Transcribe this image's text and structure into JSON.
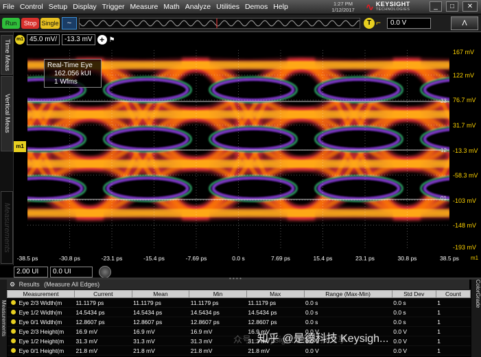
{
  "menu": [
    "File",
    "Control",
    "Setup",
    "Display",
    "Trigger",
    "Measure",
    "Math",
    "Analyze",
    "Utilities",
    "Demos",
    "Help"
  ],
  "datetime": {
    "time": "1:27 PM",
    "date": "1/12/2017"
  },
  "brand": {
    "name": "KEYSIGHT",
    "sub": "TECHNOLOGIES"
  },
  "window_buttons": [
    "_",
    "□",
    "✕"
  ],
  "toolbar": {
    "run": "Run",
    "stop": "Stop",
    "single": "Single",
    "trigger_icon": "T",
    "trigger_level": "0.0 V",
    "ac_icon": "~",
    "autoscale_icon": "Λ"
  },
  "tabs": {
    "time_meas": "Time Meas",
    "vertical_meas": "Vertical Meas",
    "measurements": "Measurements"
  },
  "channel": {
    "badge": "m1",
    "scale": "45.0 mV/",
    "offset": "-13.3 mV",
    "marker": "m1"
  },
  "realtime_label": {
    "title": "Real-Time Eye",
    "count": "162.056 kUI",
    "wfms": "1 Wfms"
  },
  "y_axis": [
    "167 mV",
    "122 mV",
    "76.7 mV",
    "31.7 mV",
    "-13.3 mV",
    "-58.3 mV",
    "-103 mV",
    "-148 mV",
    "-193 mV"
  ],
  "x_axis": [
    "-38.5 ps",
    "-30.8 ps",
    "-23.1 ps",
    "-15.4 ps",
    "-7.69 ps",
    "0.0 s",
    "7.69 ps",
    "15.4 ps",
    "23.1 ps",
    "30.8 ps",
    "38.5 ps"
  ],
  "x_unit": "m1",
  "edge_labels": [
    "23",
    "12",
    "01"
  ],
  "horizontal": {
    "ui": "2.00 UI",
    "position": "0.0 UI"
  },
  "results": {
    "title": "Results",
    "subtitle": "(Measure All Edges)",
    "side_tab": "Measurements",
    "colorgrade_tab": "ColorGrade"
  },
  "table": {
    "headers": [
      "Measurement",
      "Current",
      "Mean",
      "Min",
      "Max",
      "Range (Max-Min)",
      "Std Dev",
      "Count"
    ],
    "rows": [
      [
        "Eye 2/3 Width(m",
        "11.1179 ps",
        "11.1179 ps",
        "11.1179 ps",
        "11.1179 ps",
        "0.0 s",
        "0.0 s",
        "1"
      ],
      [
        "Eye 1/2 Width(m",
        "14.5434 ps",
        "14.5434 ps",
        "14.5434 ps",
        "14.5434 ps",
        "0.0 s",
        "0.0 s",
        "1"
      ],
      [
        "Eye 0/1 Width(m",
        "12.8607 ps",
        "12.8607 ps",
        "12.8607 ps",
        "12.8607 ps",
        "0.0 s",
        "0.0 s",
        "1"
      ],
      [
        "Eye 2/3 Height(m",
        "16.9 mV",
        "16.9 mV",
        "16.9 mV",
        "16.9 mV",
        "0.0 V",
        "0.0 V",
        "1"
      ],
      [
        "Eye 1/2 Height(m",
        "31.3 mV",
        "31.3 mV",
        "31.3 mV",
        "31.3 mV",
        "0.0 V",
        "0.0 V",
        "1"
      ],
      [
        "Eye 0/1 Height(m",
        "21.8 mV",
        "21.8 mV",
        "21.8 mV",
        "21.8 mV",
        "0.0 V",
        "0.0 V",
        "1"
      ]
    ]
  },
  "watermark": "知乎 @是德科技 Keysigh...",
  "watermark_faint": "众号 · Keysight是德科技分享",
  "colors": {
    "trace_hot": "#ffd020",
    "trace_mid": "#ff7a00",
    "trace_warm": "#e0323a",
    "edge": "#8a3fd8",
    "channel": "#e8d020"
  }
}
